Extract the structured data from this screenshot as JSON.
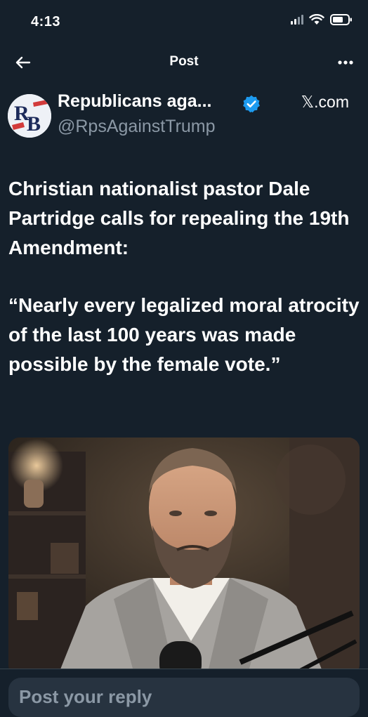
{
  "status_bar": {
    "time": "4:13"
  },
  "nav": {
    "back_icon": "arrow-left-icon",
    "title": "Post",
    "more_icon": "more-horizontal-icon"
  },
  "author": {
    "avatar_letters": "RB",
    "name": "Republicans aga...",
    "verified_icon": "verified-badge-icon",
    "source": "𝕏.com",
    "handle": "@RpsAgainstTrump"
  },
  "tweet": {
    "paragraph_1": "Christian nationalist pastor Dale Partridge calls for repealing the 19th Amendment:",
    "paragraph_2": "“Nearly every legalized moral atrocity of the last 100 years was made possible by the female vote.”"
  },
  "media": {
    "kind": "video-still-of-bearded-man-at-microphone"
  },
  "reply": {
    "placeholder": "Post your reply"
  },
  "colors": {
    "background": "#15202b",
    "text": "#ffffff",
    "secondary_text": "#8b98a5",
    "verified_blue": "#1d9bf0",
    "input_bg": "#273340"
  }
}
